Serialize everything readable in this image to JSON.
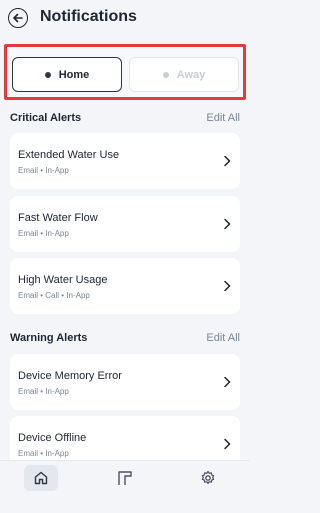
{
  "header": {
    "title": "Notifications"
  },
  "mode_selector": {
    "options": [
      {
        "label": "Home",
        "selected": true
      },
      {
        "label": "Away",
        "selected": false
      }
    ],
    "highlight_color": "#e23b3b"
  },
  "sections": [
    {
      "title": "Critical Alerts",
      "action": "Edit All",
      "items": [
        {
          "title": "Extended Water Use",
          "channels": "Email • In-App"
        },
        {
          "title": "Fast Water Flow",
          "channels": "Email • In-App"
        },
        {
          "title": "High Water Usage",
          "channels": "Email • Call • In-App"
        }
      ]
    },
    {
      "title": "Warning Alerts",
      "action": "Edit All",
      "items": [
        {
          "title": "Device Memory Error",
          "channels": "Email • In-App"
        },
        {
          "title": "Device Offline",
          "channels": "Email • In-App"
        }
      ]
    }
  ],
  "tabbar": {
    "items": [
      {
        "icon": "home-icon",
        "active": true
      },
      {
        "icon": "devices-icon",
        "active": false
      },
      {
        "icon": "gear-icon",
        "active": false
      }
    ]
  }
}
